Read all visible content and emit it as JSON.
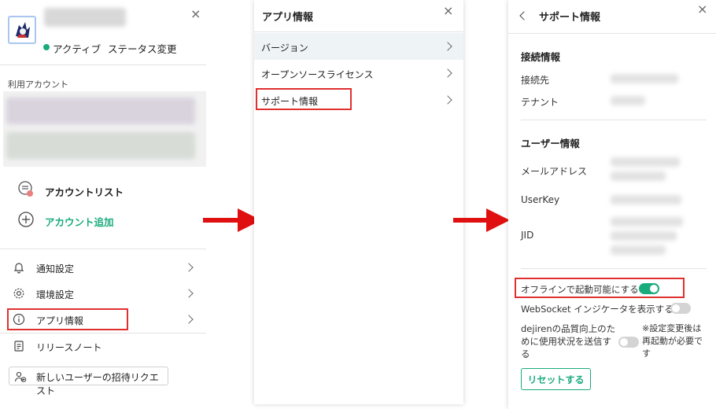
{
  "panel1": {
    "status_label": "アクティブ",
    "status_change_label": "ステータス変更",
    "accounts_section_label": "利用アカウント",
    "account_list_label": "アカウントリスト",
    "add_account_label": "アカウント追加",
    "menu": [
      {
        "label": "通知設定"
      },
      {
        "label": "環境設定"
      },
      {
        "label": "アプリ情報"
      },
      {
        "label": "リリースノート"
      }
    ],
    "invite_button_label": "新しいユーザーの招待リクエスト",
    "close_glyph": "×",
    "accent_color": "#1aab7d"
  },
  "panel2": {
    "title": "アプリ情報",
    "close_glyph": "×",
    "items": [
      {
        "label": "バージョン"
      },
      {
        "label": "オープンソースライセンス"
      },
      {
        "label": "サポート情報"
      }
    ]
  },
  "panel3": {
    "title": "サポート情報",
    "close_glyph": "×",
    "connection_section": "接続情報",
    "connection_fields": [
      {
        "label": "接続先"
      },
      {
        "label": "テナント"
      }
    ],
    "user_section": "ユーザー情報",
    "user_fields": [
      {
        "label": "メールアドレス"
      },
      {
        "label": "UserKey"
      },
      {
        "label": "JID"
      }
    ],
    "offline_toggle_label": "オフラインで起動可能にする",
    "offline_toggle_on": true,
    "websocket_toggle_label": "WebSocket インジケータを表示する",
    "websocket_toggle_on": false,
    "quality_label_line1": "dejirenの品質向上のた",
    "quality_label_line2": "めに使用状況を送信す",
    "quality_label_line3": "る",
    "quality_toggle_on": false,
    "restart_note_line1": "※設定変更後は",
    "restart_note_line2": "再起動が必要で",
    "restart_note_line3": "す",
    "reset_button_label": "リセットする"
  },
  "colors": {
    "highlight_red": "#e03030",
    "arrow_red": "#e01010",
    "accent_green": "#1aab7d"
  }
}
